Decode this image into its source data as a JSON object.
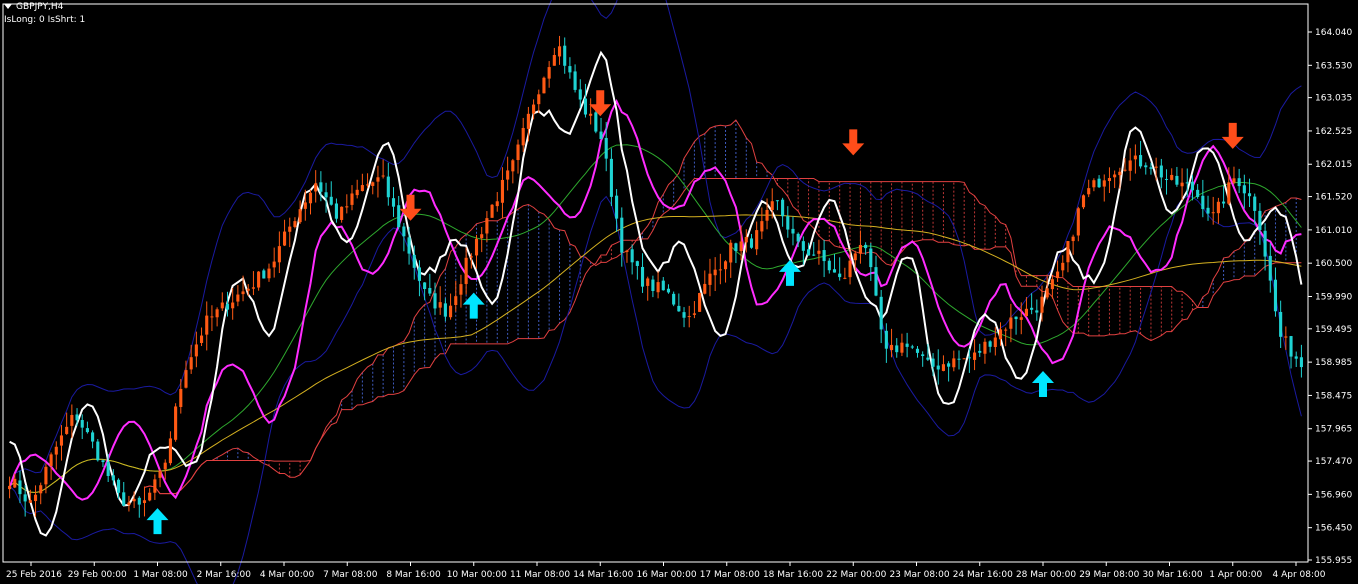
{
  "header": {
    "symbol": "GBPJPY,H4",
    "status": "IsLong: 0 IsShrt: 1"
  },
  "colors": {
    "background": "#000000",
    "axis": "#ffffff",
    "bull_candle": "#ff5a14",
    "bear_candle": "#1fd3d3",
    "kumo_up": "#e04040",
    "kumo_down": "#4a6be0",
    "bollinger": "#1a1aa0",
    "tenkan": "#ffffff",
    "kijun": "#ff2cff",
    "ma_green": "#2ea82e",
    "ma_gold": "#d4b020",
    "arrow_up": "#00e5ff",
    "arrow_down": "#ff4d1a"
  },
  "chart_data": {
    "type": "candlestick",
    "ylim": [
      155.955,
      164.04
    ],
    "y_ticks": [
      "164.040",
      "163.530",
      "163.035",
      "162.525",
      "162.015",
      "161.520",
      "161.010",
      "160.500",
      "159.990",
      "159.495",
      "158.985",
      "158.475",
      "157.965",
      "157.470",
      "156.960",
      "156.450",
      "155.955"
    ],
    "x_ticks": [
      "25 Feb 2016",
      "29 Feb 00:00",
      "1 Mar 08:00",
      "2 Mar 16:00",
      "4 Mar 00:00",
      "7 Mar 08:00",
      "8 Mar 16:00",
      "10 Mar 00:00",
      "11 Mar 08:00",
      "14 Mar 16:00",
      "16 Mar 00:00",
      "17 Mar 08:00",
      "18 Mar 16:00",
      "22 Mar 00:00",
      "23 Mar 08:00",
      "24 Mar 16:00",
      "28 Mar 00:00",
      "29 Mar 08:00",
      "30 Mar 16:00",
      "1 Apr 00:00",
      "4 Apr 08:00"
    ],
    "close_path": [
      157.2,
      156.8,
      157.6,
      158.2,
      157.6,
      156.9,
      156.75,
      157.3,
      158.9,
      159.6,
      159.9,
      160.15,
      160.5,
      161.2,
      161.75,
      161.2,
      161.65,
      161.8,
      160.9,
      160.0,
      159.75,
      160.6,
      161.35,
      162.0,
      163.05,
      163.9,
      163.0,
      162.45,
      160.7,
      160.2,
      160.05,
      159.65,
      160.3,
      160.75,
      160.85,
      161.45,
      160.75,
      160.6,
      160.2,
      160.95,
      159.1,
      159.3,
      158.9,
      159.0,
      159.05,
      159.4,
      159.7,
      159.85,
      160.35,
      161.5,
      161.85,
      162.05,
      162.05,
      161.75,
      161.65,
      161.2,
      161.85,
      161.3,
      159.4,
      158.95
    ],
    "arrows_up": [
      [
        "1 Mar 08:00",
        156.75
      ],
      [
        "10 Mar 00:00",
        160.05
      ],
      [
        "18 Mar 16:00",
        160.55
      ],
      [
        "28 Mar 00:00",
        158.85
      ]
    ],
    "arrows_down": [
      [
        "8 Mar 16:00",
        161.15
      ],
      [
        "14 Mar 16:00",
        162.75
      ],
      [
        "22 Mar 00:00",
        162.15
      ],
      [
        "1 Apr 00:00",
        162.25
      ]
    ]
  }
}
